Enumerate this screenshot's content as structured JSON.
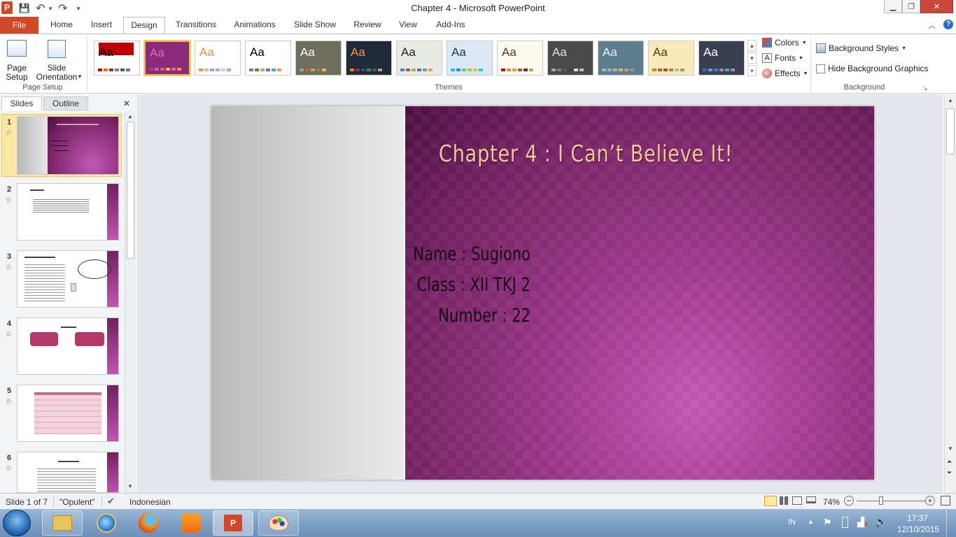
{
  "window": {
    "title": "Chapter 4  -  Microsoft PowerPoint",
    "minimize": "▁",
    "restore": "❐",
    "close": "✕"
  },
  "qat": {
    "save": "💾",
    "undo": "↶",
    "redo": "↷",
    "customize": "▾",
    "app_icon": "P"
  },
  "tabs": {
    "file": "File",
    "items": [
      "Home",
      "Insert",
      "Design",
      "Transitions",
      "Animations",
      "Slide Show",
      "Review",
      "View",
      "Add-Ins"
    ],
    "active": "Design"
  },
  "ribbon": {
    "page_setup": {
      "page_setup_label": "Page\nSetup",
      "page_setup_line1": "Page",
      "page_setup_line2": "Setup",
      "orientation_line1": "Slide",
      "orientation_line2": "Orientation",
      "group_label": "Page Setup"
    },
    "themes": {
      "group_label": "Themes",
      "sample_text": "Aa",
      "themes": [
        {
          "bg": "#ffffff",
          "top": "#c00000",
          "text": "#000000",
          "dots": [
            "#c00000",
            "#e46c0a",
            "#953735",
            "#7f7f7f",
            "#595959",
            "#8064a2"
          ]
        },
        {
          "bg": "#8a2a78",
          "top": "",
          "text": "#d96ec5",
          "dots": [
            "#b83d68",
            "#ac66bb",
            "#de6c36",
            "#f9b639",
            "#cf6da4",
            "#fa8d3d"
          ],
          "selected": true
        },
        {
          "bg": "#ffffff",
          "top": "",
          "text": "#e28e4c",
          "dots": [
            "#ef8d4e",
            "#e3b8a3",
            "#a5a5a5",
            "#8eb4e3",
            "#b9cde5",
            "#d99694"
          ]
        },
        {
          "bg": "#ffffff",
          "top": "",
          "text": "#000000",
          "dots": [
            "#4f81bd",
            "#c0504d",
            "#9bbb59",
            "#8064a2",
            "#4bacc6",
            "#f79646"
          ]
        },
        {
          "bg": "#6d6e5c",
          "top": "",
          "text": "#ffffff",
          "dots": [
            "#93a299",
            "#cf543f",
            "#b5ae53",
            "#848058",
            "#e8b54d",
            "#786c71"
          ]
        },
        {
          "bg": "#1e2a38",
          "top": "",
          "text": "#f79646",
          "dots": [
            "#f07f09",
            "#9f2936",
            "#1b587c",
            "#4e8542",
            "#604878",
            "#c19859"
          ]
        },
        {
          "bg": "#e8ebe4",
          "top": "",
          "text": "#1f1f1f",
          "dots": [
            "#4f81bd",
            "#c0504d",
            "#9bbb59",
            "#8064a2",
            "#4bacc6",
            "#f79646"
          ]
        },
        {
          "bg": "#dbe9f7",
          "top": "",
          "text": "#1f3c60",
          "dots": [
            "#31b6fd",
            "#4584d3",
            "#5bd078",
            "#a5d028",
            "#f5c040",
            "#05e0db"
          ]
        },
        {
          "bg": "#fffaf0",
          "top": "",
          "text": "#553820",
          "dots": [
            "#a9122a",
            "#d98a3a",
            "#e0a032",
            "#7a6a43",
            "#5d3a1f",
            "#aab057"
          ]
        },
        {
          "bg": "#4a4a4a",
          "top": "",
          "text": "#e0e0e0",
          "dots": [
            "#a5a5a5",
            "#7f7f7f",
            "#595959",
            "#3f3f3f",
            "#d8d8d8",
            "#bfbfbf"
          ]
        },
        {
          "bg": "#5f7d8f",
          "top": "",
          "text": "#e6f0f3",
          "dots": [
            "#8ec6c5",
            "#92b1b5",
            "#a4c58a",
            "#c8b58a",
            "#d5945a",
            "#7c9cb6"
          ]
        },
        {
          "bg": "#f9e9bb",
          "top": "",
          "text": "#4f3a10",
          "dots": [
            "#e48312",
            "#bd582c",
            "#865640",
            "#9b8357",
            "#c2bc80",
            "#94a088"
          ]
        },
        {
          "bg": "#3b3f52",
          "top": "",
          "text": "#ffffff",
          "dots": [
            "#4a66ac",
            "#629dd1",
            "#297fd5",
            "#7f8fa9",
            "#5aa2ae",
            "#9d90a0"
          ]
        }
      ]
    },
    "theme_options": {
      "colors": "Colors",
      "fonts": "Fonts",
      "effects": "Effects"
    },
    "background": {
      "styles": "Background Styles",
      "hide_graphics": "Hide Background Graphics",
      "group_label": "Background"
    }
  },
  "panel": {
    "tab_slides": "Slides",
    "tab_outline": "Outline",
    "close": "✕",
    "slides": [
      {
        "num": "1",
        "selected": true
      },
      {
        "num": "2"
      },
      {
        "num": "3"
      },
      {
        "num": "4"
      },
      {
        "num": "5"
      },
      {
        "num": "6"
      }
    ]
  },
  "slide": {
    "title": "Chapter 4 : I Can’t Believe It!",
    "name": "Name : Sugiono",
    "class": "Class : XII TKJ 2",
    "number": "Number : 22"
  },
  "status": {
    "slide_of": "Slide 1 of 7",
    "theme": "\"Opulent\"",
    "language": "Indonesian",
    "zoom": "74%",
    "zoom_level": 0.74
  },
  "taskbar": {
    "lang": "IN",
    "time": "17:37",
    "date": "12/10/2015"
  }
}
